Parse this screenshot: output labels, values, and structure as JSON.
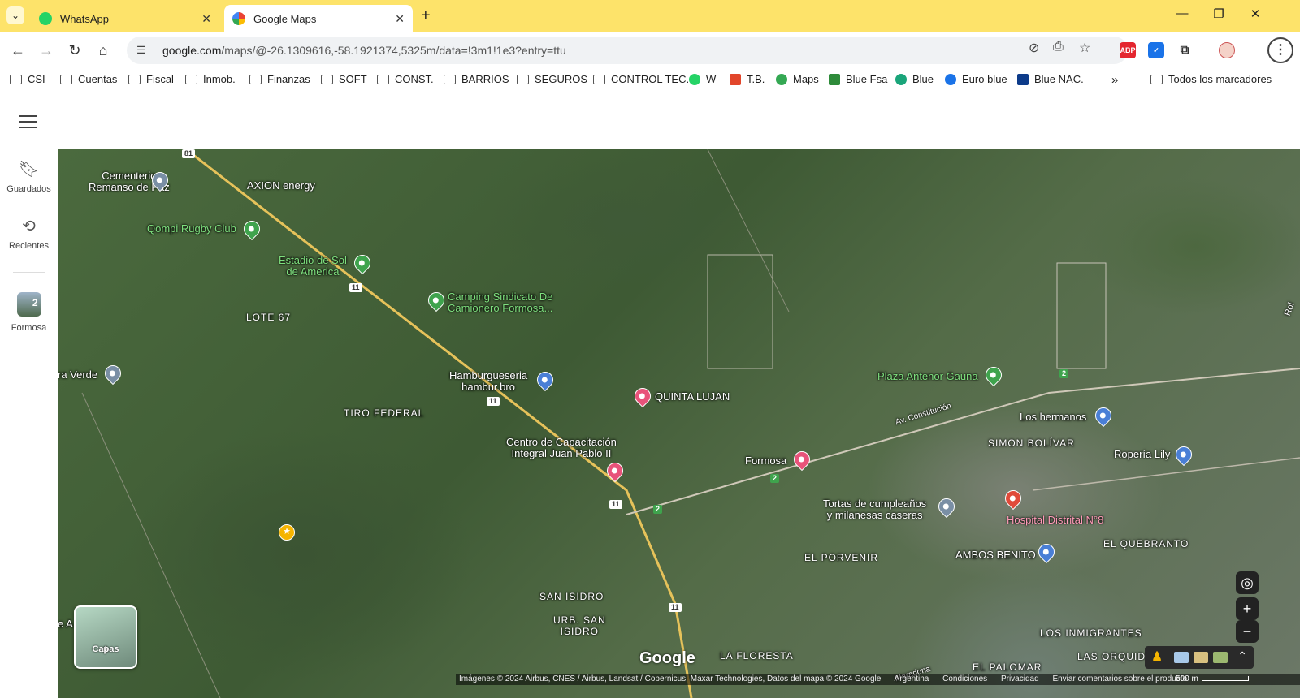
{
  "tabs": [
    {
      "title": "WhatsApp",
      "active": false,
      "icon": "whatsapp-icon"
    },
    {
      "title": "Google Maps",
      "active": true,
      "icon": "maps-icon"
    }
  ],
  "toolbar": {
    "url_host": "google.com",
    "url_path": "/maps/@-26.1309616,-58.1921374,5325m/data=!3m1!1e3?entry=ttu"
  },
  "bookmarks": [
    {
      "label": "CSI",
      "type": "folder"
    },
    {
      "label": "Cuentas",
      "type": "folder"
    },
    {
      "label": "Fiscal",
      "type": "folder"
    },
    {
      "label": "Inmob.",
      "type": "folder"
    },
    {
      "label": "Finanzas",
      "type": "folder"
    },
    {
      "label": "SOFT",
      "type": "folder"
    },
    {
      "label": "CONST.",
      "type": "folder"
    },
    {
      "label": "BARRIOS",
      "type": "folder"
    },
    {
      "label": "SEGUROS",
      "type": "folder"
    },
    {
      "label": "CONTROL TEC.",
      "type": "folder"
    },
    {
      "label": "W",
      "type": "site",
      "color": "#25d366"
    },
    {
      "label": "T.B.",
      "type": "site",
      "color": "#e2462b"
    },
    {
      "label": "Maps",
      "type": "site",
      "color": "#34a853"
    },
    {
      "label": "Blue Fsa",
      "type": "site",
      "color": "#2e8b3a"
    },
    {
      "label": "Blue",
      "type": "site",
      "color": "#1aa57a"
    },
    {
      "label": "Euro blue",
      "type": "site",
      "color": "#1a73e8"
    },
    {
      "label": "Blue NAC.",
      "type": "site",
      "color": "#0d3b8a"
    },
    {
      "label": "»",
      "type": "more"
    },
    {
      "label": "Todos los marcadores",
      "type": "folder"
    }
  ],
  "rail": {
    "saved": "Guardados",
    "recent": "Recientes",
    "recent_place": "Formosa",
    "recent_count": "2"
  },
  "map": {
    "labels": [
      {
        "text": "Cementerio\nRemanso de Paz",
        "style": "white"
      },
      {
        "text": "AXION energy",
        "style": "white"
      },
      {
        "text": "Qompi Rugby Club",
        "style": "green"
      },
      {
        "text": "Estadio de Sol\nde America",
        "style": "green"
      },
      {
        "text": "Camping Sindicato De\nCamionero Formosa...",
        "style": "green"
      },
      {
        "text": "LOTE 67",
        "style": "caps"
      },
      {
        "text": "ra Verde",
        "style": "white"
      },
      {
        "text": "Hamburgueseria\nhambur.bro",
        "style": "white"
      },
      {
        "text": "QUINTA LUJAN",
        "style": "white"
      },
      {
        "text": "TIRO FEDERAL",
        "style": "caps"
      },
      {
        "text": "Centro de Capacitación\nIntegral Juan Pablo II",
        "style": "white"
      },
      {
        "text": "Formosa",
        "style": "white"
      },
      {
        "text": "Plaza Antenor Gauna",
        "style": "green"
      },
      {
        "text": "Los hermanos",
        "style": "white"
      },
      {
        "text": "SIMON BOLÍVAR",
        "style": "caps"
      },
      {
        "text": "Ropería Lily",
        "style": "white"
      },
      {
        "text": "Tortas de cumpleaños\ny milanesas caseras",
        "style": "white"
      },
      {
        "text": "Hospital Distrital N°8",
        "style": "pink"
      },
      {
        "text": "EL QUEBRANTO",
        "style": "caps"
      },
      {
        "text": "EL PORVENIR",
        "style": "caps"
      },
      {
        "text": "AMBOS BENITO",
        "style": "white"
      },
      {
        "text": "SAN ISIDRO",
        "style": "caps"
      },
      {
        "text": "URB. SAN\nISIDRO",
        "style": "caps"
      },
      {
        "text": "LA FLORESTA",
        "style": "caps"
      },
      {
        "text": "LOS INMIGRANTES",
        "style": "caps"
      },
      {
        "text": "LAS ORQUIDE",
        "style": "caps"
      },
      {
        "text": "EL PALOMAR",
        "style": "caps"
      },
      {
        "text": "e A",
        "style": "white"
      },
      {
        "text": "Av. Constitución",
        "style": "white"
      },
      {
        "text": "Maradona",
        "style": "white"
      },
      {
        "text": "Rol",
        "style": "white"
      }
    ],
    "route_shields": [
      "81",
      "11",
      "11",
      "11",
      "11",
      "11",
      "2",
      "2",
      "2"
    ],
    "layers_label": "Capas",
    "google": "Google",
    "attribution": [
      "Imágenes © 2024 Airbus, CNES / Airbus, Landsat / Copernicus, Maxar Technologies, Datos del mapa © 2024 Google",
      "Argentina",
      "Condiciones",
      "Privacidad",
      "Enviar comentarios sobre el producto"
    ],
    "scale": "500 m"
  },
  "colors": {
    "tabstrip": "#fde36a",
    "accent_whatsapp": "#25d366",
    "accent_pink": "#e8537a",
    "accent_blue": "#4a7fd6",
    "accent_green": "#3fa34d"
  }
}
